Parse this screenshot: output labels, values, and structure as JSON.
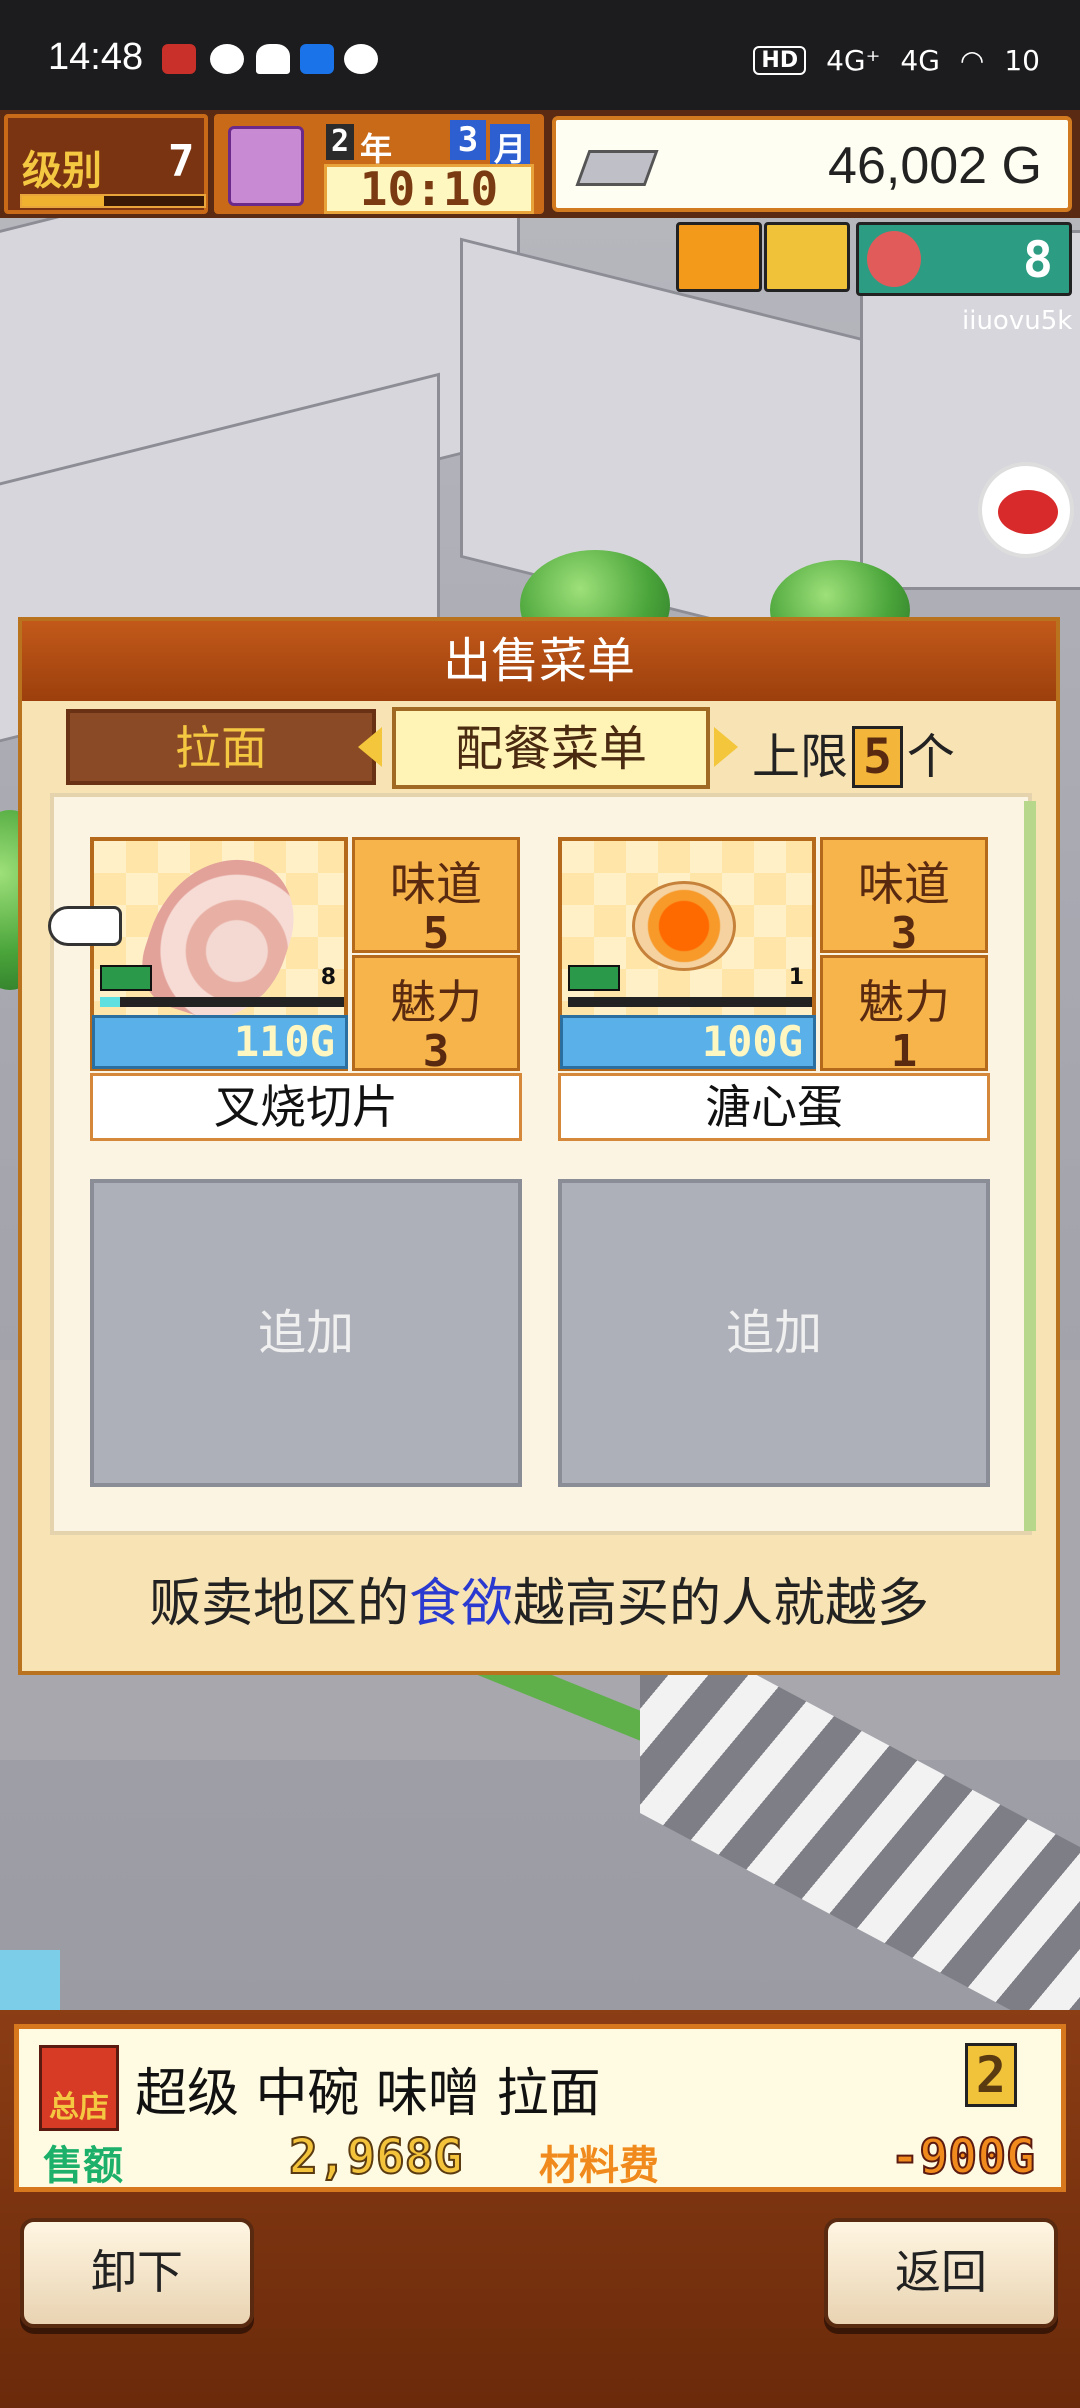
{
  "status_bar": {
    "time": "14:48",
    "indicators": [
      "HD",
      "4G⁺",
      "4G",
      "wifi"
    ],
    "battery": "10"
  },
  "hud": {
    "level_label": "级别",
    "level_value": "7",
    "level_progress": 0.45,
    "year": "2",
    "year_unit": "年",
    "month": "3",
    "month_unit": "月",
    "clock": "10:10",
    "money": "46,002 G",
    "right_counter": "8",
    "username_watermark": "iiuovu5k"
  },
  "dialog": {
    "title": "出售菜单",
    "tab_ramen": "拉面",
    "tab_combo": "配餐菜单",
    "limit_label": "上限",
    "limit_value": "5",
    "limit_unit": "个",
    "items": [
      {
        "name": "叉烧切片",
        "price": "110G",
        "taste_label": "味道",
        "taste": "5",
        "charm_label": "魅力",
        "charm": "3",
        "level_badge": "8",
        "icon": "pork-slice-icon"
      },
      {
        "name": "溏心蛋",
        "price": "100G",
        "taste_label": "味道",
        "taste": "3",
        "charm_label": "魅力",
        "charm": "1",
        "level_badge": "1",
        "icon": "soft-egg-icon"
      }
    ],
    "empty_slots": [
      "追加",
      "追加"
    ],
    "hint_before": "贩卖地区的",
    "hint_highlight": "食欲",
    "hint_after": "越高买的人就越多"
  },
  "bottom": {
    "shop_label": "总店",
    "product_title": "超级 中碗 味噌 拉面",
    "count": "2",
    "sales_label": "售额",
    "sales_value": "2,968G",
    "cost_label": "材料费",
    "cost_value": "-900G",
    "unload_button": "卸下",
    "back_button": "返回"
  }
}
